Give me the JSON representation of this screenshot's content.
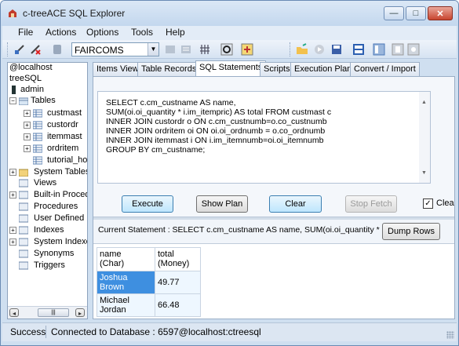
{
  "window": {
    "title": "c-treeACE SQL Explorer",
    "min_glyph": "—",
    "max_glyph": "□",
    "close_glyph": "✕"
  },
  "menu": [
    "File",
    "Actions",
    "Options",
    "Tools",
    "Help"
  ],
  "toolbar": {
    "database": "FAIRCOMS"
  },
  "tree": {
    "root": "@localhost",
    "server": "treeSQL",
    "user": "admin",
    "tables_label": "Tables",
    "tables": [
      "custmast",
      "custordr",
      "itemmast",
      "ordritem",
      "tutorial_hos"
    ],
    "nodes": [
      "System Tables",
      "Views",
      "Built-in Procedu",
      "Procedures",
      "User Defined F",
      "Indexes",
      "System Indexe",
      "Synonyms",
      "Triggers"
    ],
    "scroll_left": "◂",
    "scroll_right": "▸",
    "scroll_thumb": "|||"
  },
  "tabs": [
    "Items View",
    "Table Records",
    "SQL Statements",
    "Scripts",
    "Execution Plan",
    "Convert / Import"
  ],
  "active_tab": "SQL Statements",
  "sql": {
    "lines": [
      "SELECT c.cm_custname AS name,",
      "SUM(oi.oi_quantity * i.im_itempric) AS total FROM custmast c",
      "INNER JOIN custordr o ON c.cm_custnumb=o.co_custnumb",
      "INNER JOIN ordritem oi ON oi.oi_ordnumb = o.co_ordnumb",
      "INNER JOIN itemmast i ON i.im_itemnumb=oi.oi_itemnumb",
      "GROUP BY cm_custname;"
    ],
    "scroll_up": "▲",
    "scroll_down": "▼"
  },
  "buttons": {
    "execute": "Execute",
    "show_plan": "Show Plan",
    "clear": "Clear",
    "stop_fetch": "Stop Fetch",
    "clear_check": "Clea",
    "dump_rows": "Dump Rows"
  },
  "checkbox_mark": "✓",
  "current_statement": "Current Statement : SELECT c.cm_custname AS name,  SUM(oi.oi_quantity *",
  "results": {
    "columns": [
      [
        "name",
        "(Char)"
      ],
      [
        "total",
        "(Money)"
      ]
    ],
    "rows": [
      [
        "Joshua Brown",
        "49.77"
      ],
      [
        "Michael Jordan",
        "66.48"
      ]
    ]
  },
  "status": {
    "state": "Success",
    "connection": "Connected to Database : 6597@localhost:ctreesql"
  },
  "colors": {
    "selection": "#3e8fe0",
    "title_bar": "#c3d7ee",
    "close_button": "#c8452f"
  }
}
